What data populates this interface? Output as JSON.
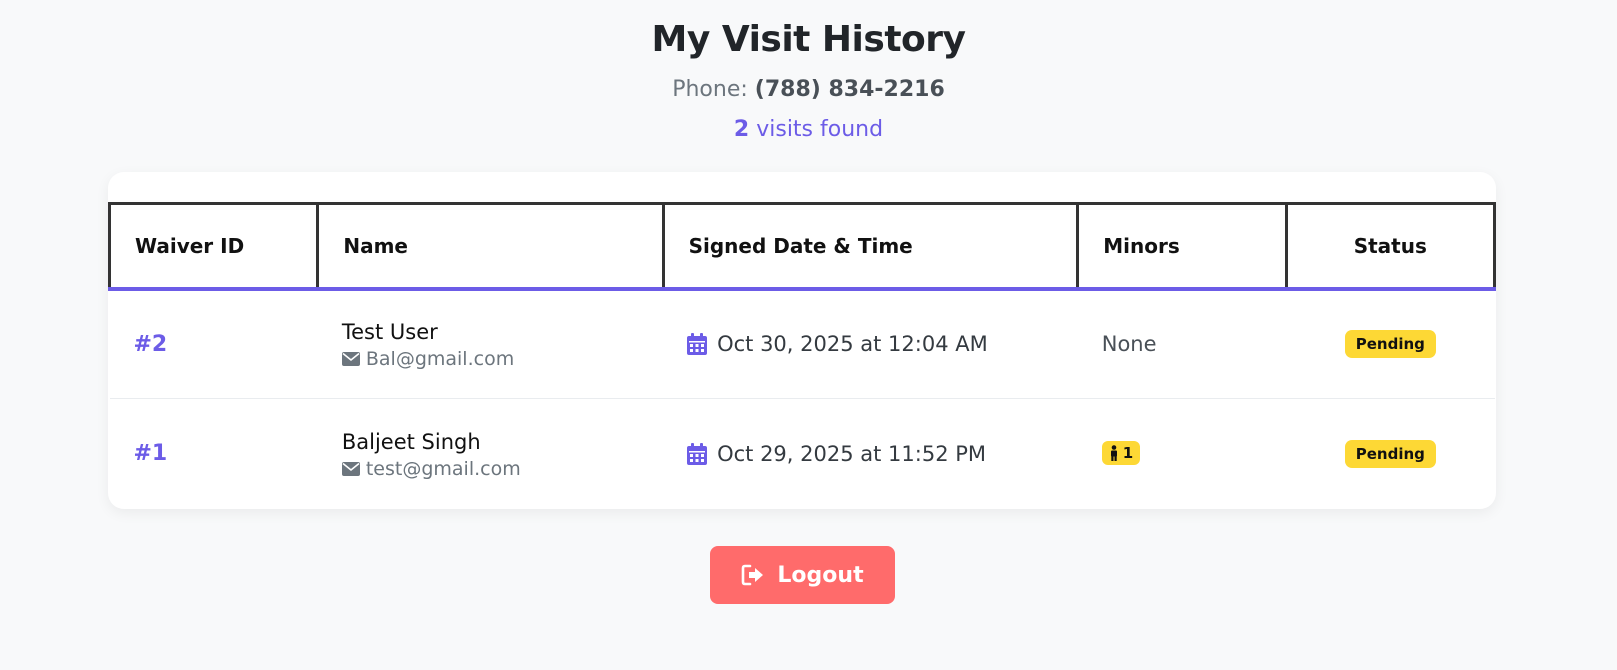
{
  "header": {
    "title": "My Visit History",
    "phone_label": "Phone: ",
    "phone_value": "(788) 834-2216",
    "visits_count": "2",
    "visits_suffix": " visits found"
  },
  "table": {
    "columns": [
      "Waiver ID",
      "Name",
      "Signed Date & Time",
      "Minors",
      "Status"
    ],
    "rows": [
      {
        "waiver_id": "#2",
        "name": "Test User",
        "email": "Bal@gmail.com",
        "signed": "Oct 30, 2025 at 12:04 AM",
        "minors": "None",
        "status": "Pending"
      },
      {
        "waiver_id": "#1",
        "name": "Baljeet Singh",
        "email": "test@gmail.com",
        "signed": "Oct 29, 2025 at 11:52 PM",
        "minors": "1",
        "status": "Pending"
      }
    ]
  },
  "actions": {
    "logout_label": "Logout"
  },
  "icons": {
    "email": "envelope-icon",
    "date": "calendar-icon",
    "minor": "child-icon",
    "logout": "sign-out-icon"
  },
  "colors": {
    "accent": "#6c5ce7",
    "badge": "#fdd835",
    "logout": "#ff6b6b",
    "background": "#f8f9fa"
  }
}
